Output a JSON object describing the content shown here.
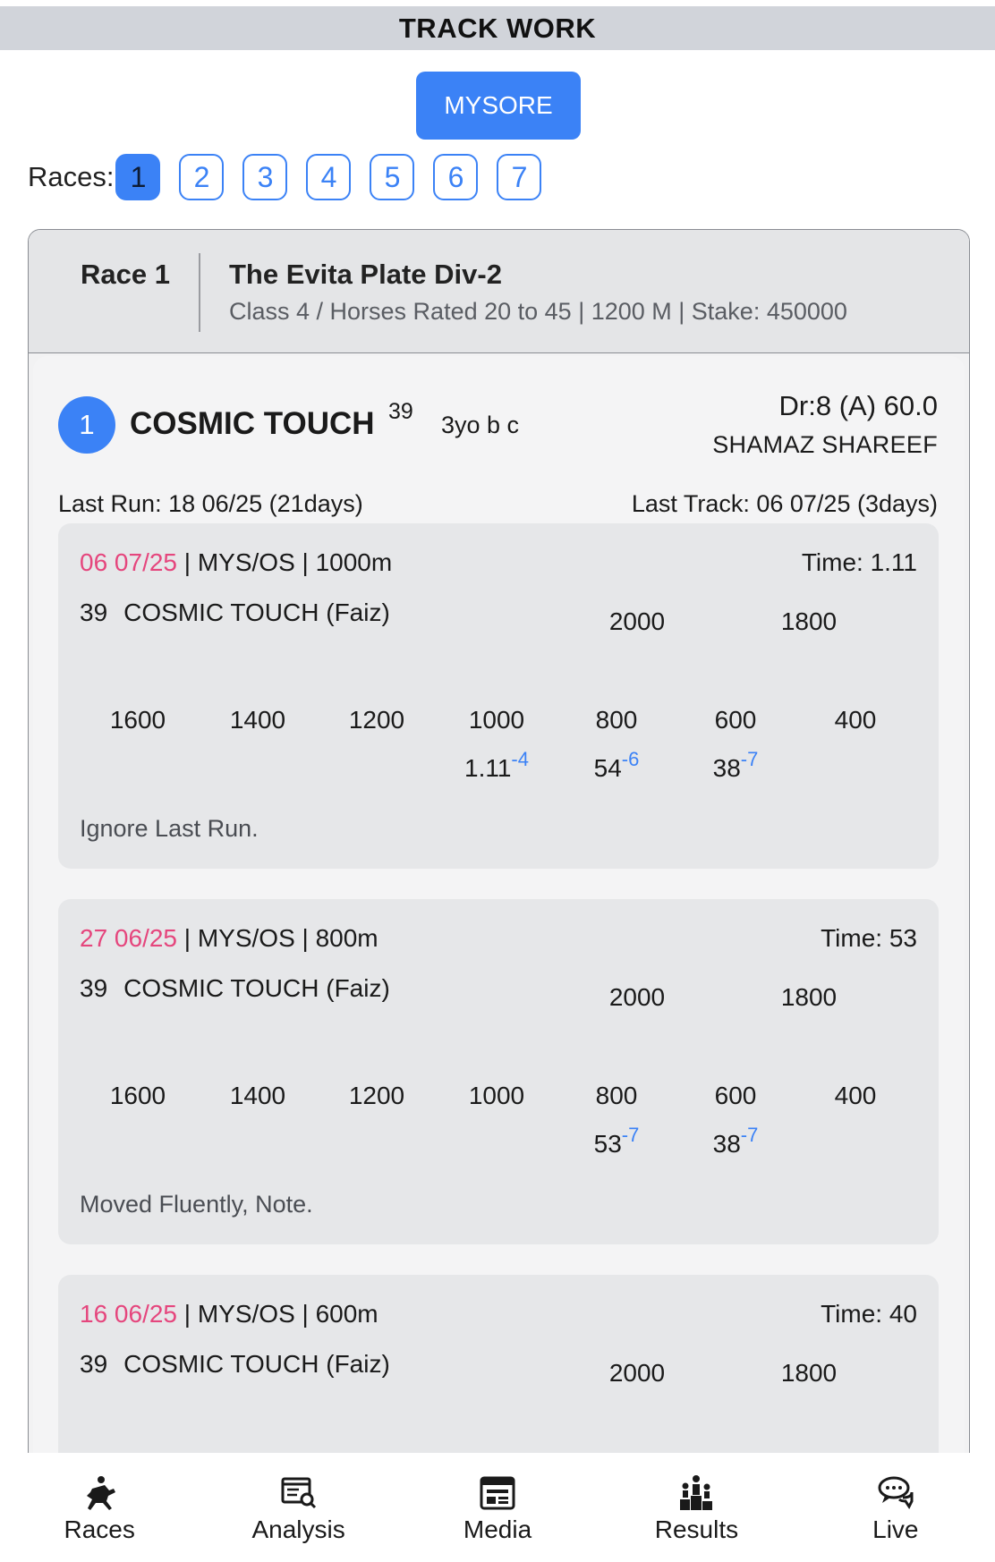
{
  "header": {
    "title": "TRACK WORK"
  },
  "venue": {
    "label": "MYSORE"
  },
  "races": {
    "label": "Races:",
    "items": [
      "1",
      "2",
      "3",
      "4",
      "5",
      "6",
      "7"
    ],
    "active": "1"
  },
  "race": {
    "number_label": "Race 1",
    "name": "The Evita Plate Div-2",
    "details": "Class 4 / Horses Rated 20 to 45 | 1200 M | Stake: 450000"
  },
  "horse": {
    "number": "1",
    "name": "COSMIC TOUCH",
    "rating": "39",
    "desc": "3yo b c",
    "draw_weight": "Dr:8 (A) 60.0",
    "jockey": "SHAMAZ SHAREEF",
    "last_run": "Last Run: 18 06/25 (21days)",
    "last_track": "Last Track: 06 07/25 (3days)"
  },
  "work_cards": [
    {
      "date": "06 07/25",
      "info": " | MYS/OS | 1000m",
      "time": "Time: 1.11",
      "horse_num": "39",
      "horse_name": "COSMIC TOUCH (Faiz)",
      "top_labels": [
        "2000",
        "1800"
      ],
      "labels": [
        "1600",
        "1400",
        "1200",
        "1000",
        "800",
        "600",
        "400"
      ],
      "values": [
        {
          "v": "1.11",
          "s": "-4"
        },
        {
          "v": "54",
          "s": "-6"
        },
        {
          "v": "38",
          "s": "-7"
        }
      ],
      "note": "Ignore Last Run."
    },
    {
      "date": "27 06/25",
      "info": " | MYS/OS | 800m",
      "time": "Time: 53",
      "horse_num": "39",
      "horse_name": "COSMIC TOUCH (Faiz)",
      "top_labels": [
        "2000",
        "1800"
      ],
      "labels": [
        "1600",
        "1400",
        "1200",
        "1000",
        "800",
        "600",
        "400"
      ],
      "values": [
        {
          "v": "53",
          "s": "-7"
        },
        {
          "v": "38",
          "s": "-7"
        }
      ],
      "note": "Moved Fluently, Note."
    },
    {
      "date": "16 06/25",
      "info": " | MYS/OS | 600m",
      "time": "Time: 40",
      "horse_num": "39",
      "horse_name": "COSMIC TOUCH (Faiz)",
      "top_labels": [
        "2000",
        "1800"
      ]
    }
  ],
  "nav": [
    {
      "label": "Races",
      "icon": "jockey-icon"
    },
    {
      "label": "Analysis",
      "icon": "analysis-icon"
    },
    {
      "label": "Media",
      "icon": "media-icon"
    },
    {
      "label": "Results",
      "icon": "results-icon"
    },
    {
      "label": "Live",
      "icon": "chat-icon"
    }
  ]
}
